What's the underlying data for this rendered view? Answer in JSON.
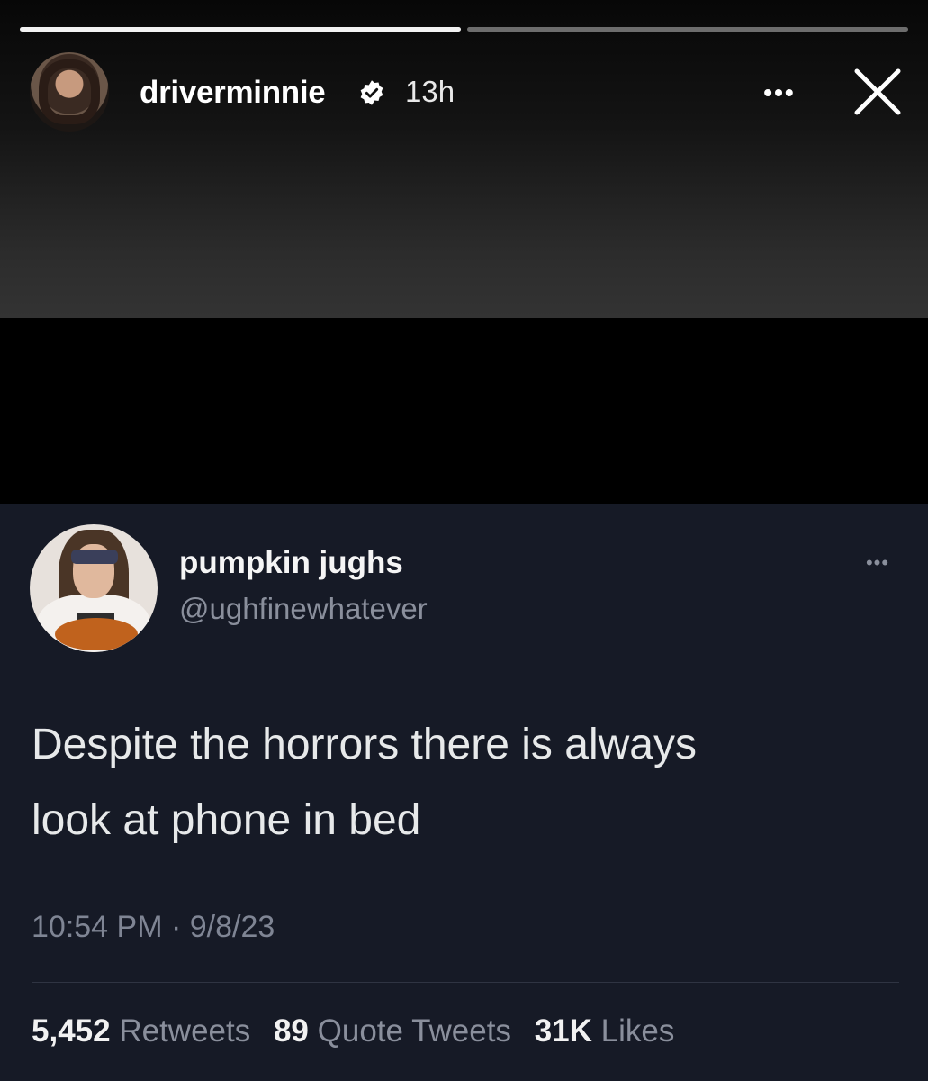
{
  "story": {
    "username": "driverminnie",
    "time": "13h",
    "more_icon": "more-horizontal-icon",
    "close_icon": "close-icon",
    "verified_icon": "verified-badge-icon",
    "progress": [
      1.0,
      0.0
    ],
    "progress_fill_color": "#f2f2f2"
  },
  "tweet": {
    "display_name": "pumpkin jughs",
    "handle": "@ughfinewhatever",
    "text_line1": "Despite the horrors there is always",
    "text_line2": "look at phone in bed",
    "timestamp": "10:54 PM · 9/8/23",
    "stats": {
      "retweets_count": "5,452",
      "retweets_label": "Retweets",
      "quotes_count": "89",
      "quotes_label": "Quote Tweets",
      "likes_count": "31K",
      "likes_label": "Likes"
    },
    "background_color": "#161a26"
  }
}
